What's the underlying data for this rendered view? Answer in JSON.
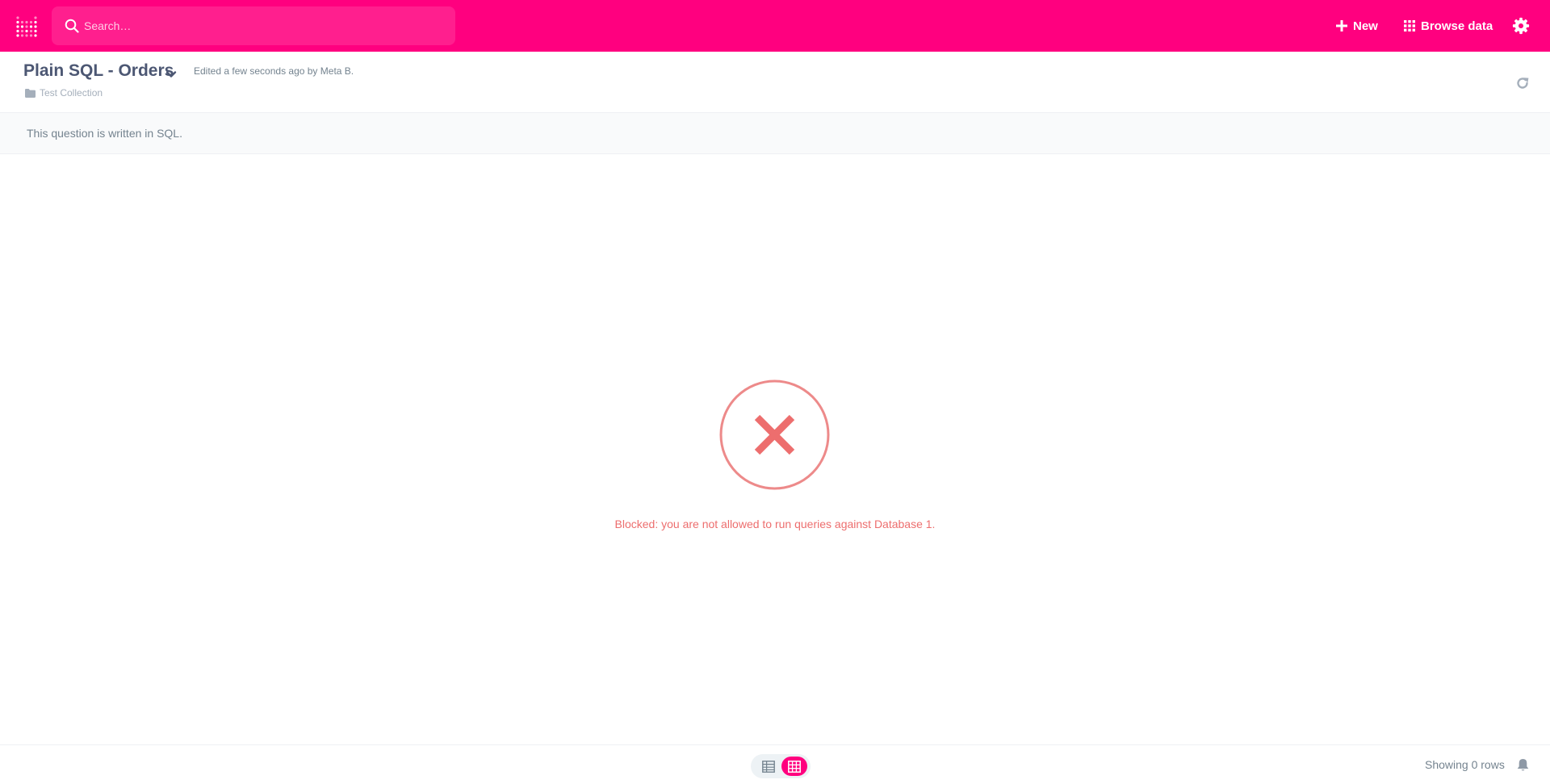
{
  "nav": {
    "search_placeholder": "Search…",
    "new_label": "New",
    "browse_label": "Browse data"
  },
  "question": {
    "title": "Plain SQL - Orders",
    "edited": "Edited a few seconds ago by Meta B.",
    "collection": "Test Collection"
  },
  "sql_notice": "This question is written in SQL.",
  "error": {
    "message": "Blocked: you are not allowed to run queries against Database 1."
  },
  "footer": {
    "row_count": "Showing 0 rows",
    "active_view": "table-grid"
  },
  "icons": {
    "logo": "metabase-logo-icon",
    "search": "search-icon",
    "new": "plus-icon",
    "browse": "grid-icon",
    "settings": "gear-icon",
    "title_menu": "chevron-down-icon",
    "collection": "folder-icon",
    "refresh": "refresh-icon",
    "error": "close-circle-icon",
    "table_view": "table-icon",
    "grid_view": "grid-table-icon",
    "alert": "bell-icon"
  },
  "colors": {
    "brand": "#ff007f",
    "error": "#ed6e6e",
    "text_dark": "#4c5773",
    "text_medium": "#74838f",
    "text_light": "#a5afbb"
  }
}
